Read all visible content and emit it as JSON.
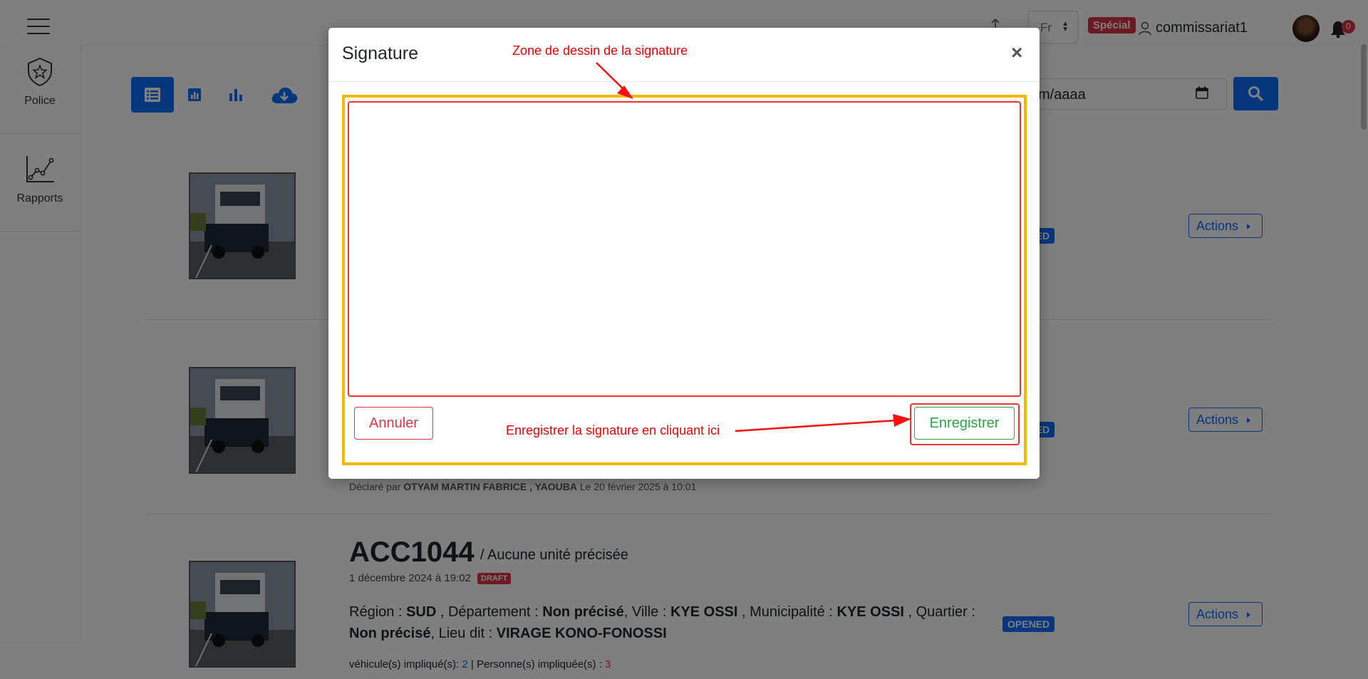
{
  "header": {
    "language": "Fr",
    "special_badge": "Spécial",
    "username": "commissariat1",
    "notification_count": "0"
  },
  "sidebar": {
    "items": [
      {
        "label": "Police",
        "icon": "police-badge-icon"
      },
      {
        "label": "Rapports",
        "icon": "line-chart-icon"
      }
    ]
  },
  "toolbar": {
    "buttons": [
      "list-icon",
      "small-bar-chart-icon",
      "bar-chart-icon",
      "cloud-download-icon"
    ],
    "date_value": "m/aaaa"
  },
  "cards": [
    {
      "status": "OPENED",
      "actions_label": "Actions"
    },
    {
      "status": "OPENED",
      "actions_label": "Actions",
      "declared_prefix": "Déclaré par",
      "declared_by": "OTYAM MARTIN FABRICE , YAOUBA",
      "declared_date": "Le 20 février 2025 à 10:01"
    },
    {
      "status": "OPENED",
      "actions_label": "Actions",
      "id": "ACC1044",
      "unit": "/ Aucune unité précisée",
      "date": "1 décembre 2024 à 19:02",
      "badge": "DRAFT",
      "region_label": "Région :",
      "region": "SUD",
      "departement_label": ", Département :",
      "departement": "Non précisé",
      "ville_label": ", Ville :",
      "ville": "KYE OSSI",
      "municipalite_label": ", Municipalité :",
      "municipalite": "KYE OSSI",
      "quartier_label": ", Quartier :",
      "quartier": "Non précisé",
      "lieu_label": ", Lieu dit :",
      "lieu": "VIRAGE KONO-FONOSSI",
      "vehicules_label": "véhicule(s) impliqué(s):",
      "vehicules": "2",
      "personnes_label": "| Personne(s) impliquée(s) :",
      "personnes": "3"
    }
  ],
  "modal": {
    "title": "Signature",
    "close": "×",
    "cancel_label": "Annuler",
    "save_label": "Enregistrer",
    "annotation_top": "Zone de dessin de la signature",
    "annotation_bottom": "Enregistrer la signature en cliquant ici"
  },
  "colors": {
    "primary": "#0d6efd",
    "danger": "#dc3545",
    "success": "#28a745",
    "annotation": "#e00000",
    "highlight": "#f5b800"
  }
}
